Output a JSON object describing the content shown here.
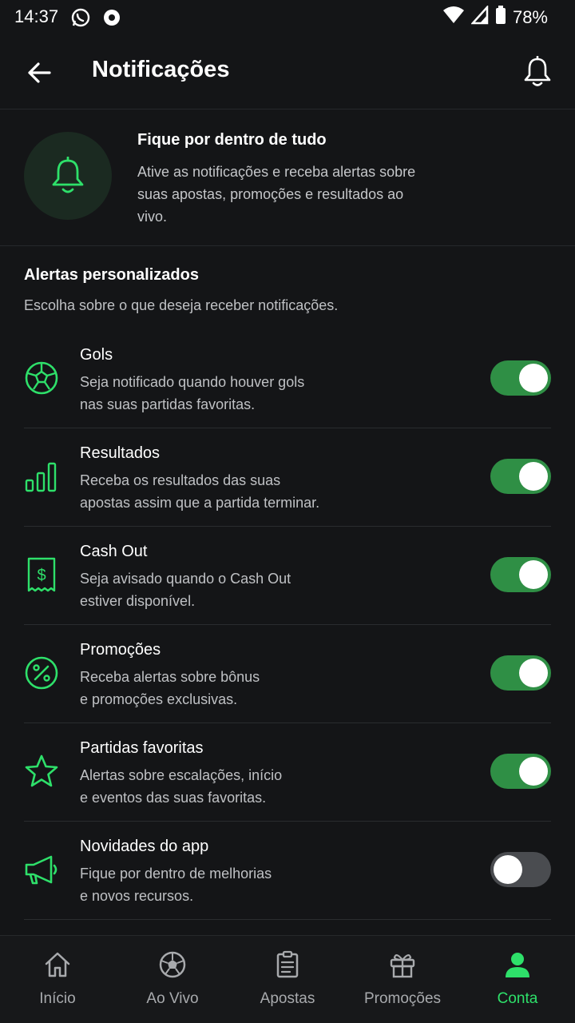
{
  "status_bar": {
    "time": "14:37",
    "battery": "78%"
  },
  "header": {
    "title": "Notificações"
  },
  "intro": {
    "title": "Fique por dentro de tudo",
    "text": "Ative as notificações e receba alertas sobre suas apostas, promoções e resultados ao vivo."
  },
  "section": {
    "title": "Alertas personalizados",
    "subtitle": "Escolha sobre o que deseja receber notificações."
  },
  "alerts": [
    {
      "icon": "soccer-ball-icon",
      "title": "Gols",
      "desc_line1": "Seja notificado quando houver gols",
      "desc_line2": "nas suas partidas favoritas.",
      "enabled": true
    },
    {
      "icon": "bar-chart-icon",
      "title": "Resultados",
      "desc_line1": "Receba os resultados das suas",
      "desc_line2": "apostas assim que a partida terminar.",
      "enabled": true
    },
    {
      "icon": "cash-receipt-icon",
      "title": "Cash Out",
      "desc_line1": "Seja avisado quando o Cash Out",
      "desc_line2": "estiver disponível.",
      "enabled": true
    },
    {
      "icon": "percent-icon",
      "title": "Promoções",
      "desc_line1": "Receba alertas sobre bônus",
      "desc_line2": "e promoções exclusivas.",
      "enabled": true
    },
    {
      "icon": "star-icon",
      "title": "Partidas favoritas",
      "desc_line1": "Alertas sobre escalações, início",
      "desc_line2": "e eventos das suas favoritas.",
      "enabled": true
    },
    {
      "icon": "megaphone-icon",
      "title": "Novidades do app",
      "desc_line1": "Fique por dentro de melhorias",
      "desc_line2": "e novos recursos.",
      "enabled": false
    }
  ],
  "bottom_nav": [
    {
      "icon": "home-icon",
      "label": "Início",
      "active": false
    },
    {
      "icon": "soccer-ball-icon",
      "label": "Ao Vivo",
      "active": false
    },
    {
      "icon": "clipboard-icon",
      "label": "Apostas",
      "active": false
    },
    {
      "icon": "gift-icon",
      "label": "Promoções",
      "active": false
    },
    {
      "icon": "user-icon",
      "label": "Conta",
      "active": true
    }
  ],
  "colors": {
    "accent": "#2ee06a",
    "toggle_on": "#2f8f45",
    "toggle_off": "#4a4c50",
    "background": "#141517"
  }
}
